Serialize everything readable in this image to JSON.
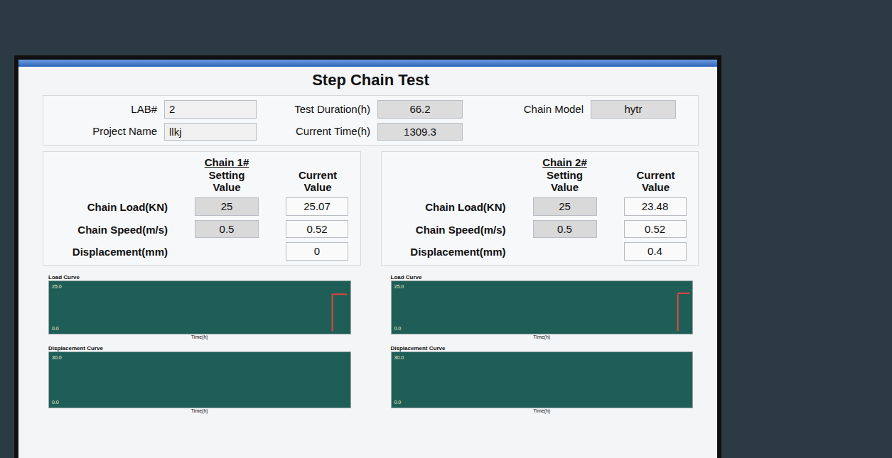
{
  "window": {
    "title": "Step Chain Test"
  },
  "info": {
    "lab": {
      "label": "LAB#",
      "value": "2"
    },
    "project": {
      "label": "Project Name",
      "value": "llkj"
    },
    "duration": {
      "label": "Test Duration(h)",
      "value": "66.2"
    },
    "current_time": {
      "label": "Current Time(h)",
      "value": "1309.3"
    },
    "chain_model": {
      "label": "Chain Model",
      "value": "hytr"
    }
  },
  "chains": [
    {
      "title": "Chain 1#",
      "setting_header": "Setting Value",
      "current_header": "Current Value",
      "rows": [
        {
          "label": "Chain Load(KN)",
          "setting": "25",
          "current": "25.07"
        },
        {
          "label": "Chain Speed(m/s)",
          "setting": "0.5",
          "current": "0.52"
        },
        {
          "label": "Displacement(mm)",
          "current": "0"
        }
      ],
      "charts": [
        {
          "title": "Load Curve",
          "y_max": "25.0",
          "y_min": "0.0",
          "x_label": "Time(h)",
          "values": [
            0,
            0,
            0,
            0,
            0,
            0,
            0,
            0,
            0,
            0,
            0,
            0,
            0,
            0,
            0,
            0,
            0,
            0,
            0,
            0,
            0,
            0,
            0,
            0,
            0,
            0,
            0,
            0,
            0,
            0,
            0,
            0,
            0,
            0,
            0,
            0,
            0,
            0,
            0,
            0,
            0,
            0,
            0,
            0,
            0,
            0,
            0,
            0,
            0,
            0,
            0,
            0,
            0,
            0,
            0,
            0,
            0,
            0,
            0,
            0,
            0,
            0,
            0,
            0,
            0,
            0,
            0,
            0,
            0,
            0,
            0,
            0,
            0,
            0,
            0,
            0,
            0,
            0,
            0,
            0,
            0,
            0,
            0,
            0,
            0,
            0,
            0,
            0,
            0,
            0,
            0,
            0,
            0,
            0,
            19.5,
            19.5,
            19.5,
            19.5,
            19.5,
            19.5
          ]
        },
        {
          "title": "Displacement Curve",
          "y_max": "30.0",
          "y_min": "0.0",
          "x_label": "Time(h)",
          "values": []
        }
      ]
    },
    {
      "title": "Chain 2#",
      "setting_header": "Setting Value",
      "current_header": "Current Value",
      "rows": [
        {
          "label": "Chain Load(KN)",
          "setting": "25",
          "current": "23.48"
        },
        {
          "label": "Chain Speed(m/s)",
          "setting": "0.5",
          "current": "0.52"
        },
        {
          "label": "Displacement(mm)",
          "current": "0.4"
        }
      ],
      "charts": [
        {
          "title": "Load Curve",
          "y_max": "25.0",
          "y_min": "0.0",
          "x_label": "Time(h)",
          "values": [
            0,
            0,
            0,
            0,
            0,
            0,
            0,
            0,
            0,
            0,
            0,
            0,
            0,
            0,
            0,
            0,
            0,
            0,
            0,
            0,
            0,
            0,
            0,
            0,
            0,
            0,
            0,
            0,
            0,
            0,
            0,
            0,
            0,
            0,
            0,
            0,
            0,
            0,
            0,
            0,
            0,
            0,
            0,
            0,
            0,
            0,
            0,
            0,
            0,
            0,
            0,
            0,
            0,
            0,
            0,
            0,
            0,
            0,
            0,
            0,
            0,
            0,
            0,
            0,
            0,
            0,
            0,
            0,
            0,
            0,
            0,
            0,
            0,
            0,
            0,
            0,
            0,
            0,
            0,
            0,
            0,
            0,
            0,
            0,
            0,
            0,
            0,
            0,
            0,
            0,
            0,
            0,
            0,
            0,
            0,
            20,
            20,
            20,
            20,
            20
          ]
        },
        {
          "title": "Displacement Curve",
          "y_max": "30.0",
          "y_min": "0.0",
          "x_label": "Time(h)",
          "values": []
        }
      ]
    }
  ]
}
